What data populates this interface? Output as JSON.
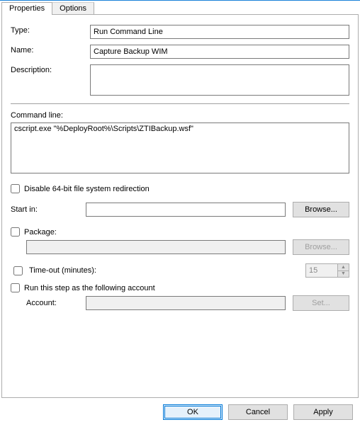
{
  "tabs": {
    "properties": "Properties",
    "options": "Options"
  },
  "form": {
    "type_label": "Type:",
    "type_value": "Run Command Line",
    "name_label": "Name:",
    "name_value": "Capture Backup WIM",
    "description_label": "Description:",
    "description_value": "",
    "command_line_label": "Command line:",
    "command_line_value": "cscript.exe \"%DeployRoot%\\Scripts\\ZTIBackup.wsf\"",
    "disable_redir_label": "Disable 64-bit file system redirection",
    "startin_label": "Start in:",
    "startin_value": "",
    "browse_label": "Browse...",
    "package_label": "Package:",
    "package_value": "",
    "browse2_label": "Browse...",
    "timeout_label": "Time-out (minutes):",
    "timeout_value": "15",
    "runas_label": "Run this step as the following account",
    "account_label": "Account:",
    "account_value": "",
    "set_label": "Set..."
  },
  "footer": {
    "ok": "OK",
    "cancel": "Cancel",
    "apply": "Apply"
  }
}
